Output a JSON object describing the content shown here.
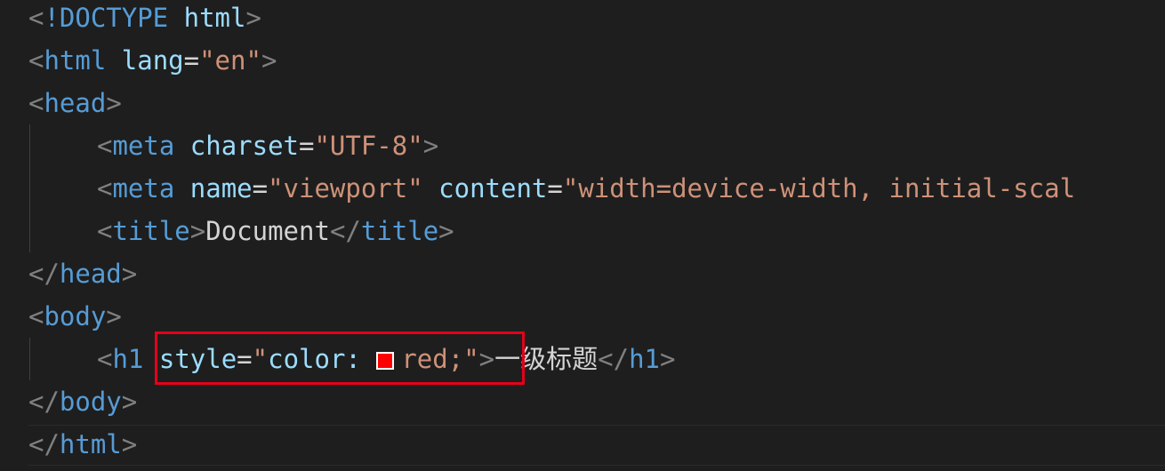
{
  "editor": {
    "theme": "dark",
    "colors": {
      "background": "#1e1e1e",
      "punctuation": "#808080",
      "tag": "#569cd6",
      "attribute": "#9cdcfe",
      "string": "#ce9178",
      "text": "#d4d4d4",
      "swatch": "#ff0000",
      "highlight_box": "#e5001a"
    },
    "lines": {
      "l1": {
        "lt": "<",
        "bang": "!DOCTYPE",
        "sp": " ",
        "name": "html",
        "gt": ">"
      },
      "l2": {
        "lt": "<",
        "tag": "html",
        "sp": " ",
        "attr": "lang",
        "eq": "=",
        "val": "\"en\"",
        "gt": ">"
      },
      "l3": {
        "lt": "<",
        "tag": "head",
        "gt": ">"
      },
      "l4": {
        "lt": "<",
        "tag": "meta",
        "sp": " ",
        "attr": "charset",
        "eq": "=",
        "val": "\"UTF-8\"",
        "gt": ">"
      },
      "l5": {
        "lt": "<",
        "tag": "meta",
        "sp1": " ",
        "attr1": "name",
        "eq1": "=",
        "val1": "\"viewport\"",
        "sp2": " ",
        "attr2": "content",
        "eq2": "=",
        "val2": "\"width=device-width, initial-scal"
      },
      "l6": {
        "lt": "<",
        "tag": "title",
        "gt": ">",
        "text": "Document",
        "lt_close": "</",
        "tag_close": "title",
        "gt_close": ">"
      },
      "l7": {
        "lt": "</",
        "tag": "head",
        "gt": ">"
      },
      "l8": {
        "lt": "<",
        "tag": "body",
        "gt": ">"
      },
      "l9": {
        "lt": "<",
        "tag": "h1",
        "sp": " ",
        "attr": "style",
        "eq": "=",
        "quote_open": "\"",
        "prop": "color:",
        "sp2": " ",
        "val": "red;",
        "quote_close": "\"",
        "gt": ">",
        "text": "一级标题",
        "lt_close": "</",
        "tag_close": "h1",
        "gt_close": ">"
      },
      "l10": {
        "lt": "</",
        "tag": "body",
        "gt": ">"
      },
      "l11": {
        "lt": "</",
        "tag": "html",
        "gt": ">"
      }
    }
  }
}
